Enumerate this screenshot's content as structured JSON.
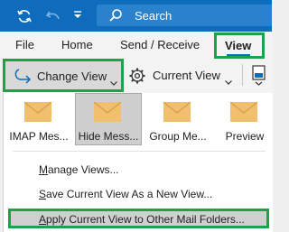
{
  "colors": {
    "accent": "#0f6cbd",
    "highlight": "#1aa34a",
    "envelope": "#f0c070"
  },
  "titlebar": {
    "icons": [
      "sync-icon",
      "undo-icon",
      "quick-access-dropdown-icon"
    ],
    "search": {
      "icon": "search-icon",
      "label": "Search"
    }
  },
  "tabs": {
    "file": "File",
    "home": "Home",
    "send_receive": "Send / Receive",
    "view": "View"
  },
  "ribbon": {
    "change_view": {
      "label": "Change View",
      "icon": "change-view-icon",
      "chevron": "chevron-down-icon"
    },
    "current_view": {
      "label": "Current View",
      "icon": "gear-icon",
      "chevron": "chevron-down-icon"
    },
    "layout_icon": "reading-pane-icon"
  },
  "menu": {
    "gallery": [
      {
        "label": "IMAP Mes...",
        "selected": false
      },
      {
        "label": "Hide Mess...",
        "selected": true
      },
      {
        "label": "Group Me...",
        "selected": false
      },
      {
        "label": "Preview",
        "selected": false
      }
    ],
    "items": [
      {
        "pre": "",
        "acc": "M",
        "post": "anage Views..."
      },
      {
        "pre": "",
        "acc": "S",
        "post": "ave Current View As a New View..."
      },
      {
        "pre": "",
        "acc": "A",
        "post": "pply Current View to Other Mail Folders..."
      }
    ]
  }
}
